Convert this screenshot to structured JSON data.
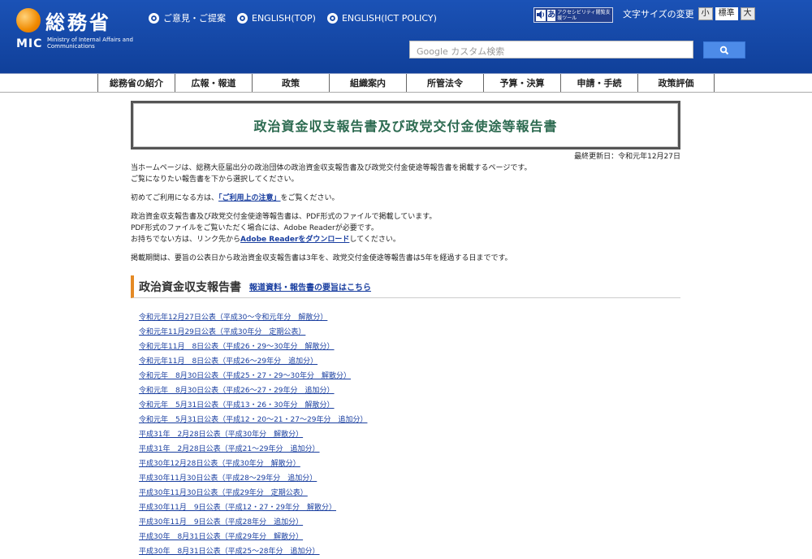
{
  "logo": {
    "jp": "総務省",
    "mic": "MIC",
    "en": "Ministry of Internal Affairs and Communications"
  },
  "toplinks": [
    "ご意見・ご提案",
    "ENGLISH(TOP)",
    "ENGLISH(ICT POLICY)"
  ],
  "accessibility": {
    "icon_a": "あ",
    "text": "アクセシビリティ閲覧支援ツール"
  },
  "fontsize": {
    "label": "文字サイズの変更",
    "small": "小",
    "normal": "標準",
    "large": "大"
  },
  "search": {
    "placeholder": "Google カスタム検索"
  },
  "nav": [
    "総務省の紹介",
    "広報・報道",
    "政策",
    "組織案内",
    "所管法令",
    "予算・決算",
    "申請・手続",
    "政策評価"
  ],
  "title": "政治資金収支報告書及び政党交付金使途等報告書",
  "last_updated": "最終更新日：令和元年12月27日",
  "intro1": "当ホームページは、総務大臣届出分の政治団体の政治資金収支報告書及び政党交付金使途等報告書を掲載するページです。",
  "intro2": "ご覧になりたい報告書を下から選択してください。",
  "notice": {
    "pre": "初めてご利用になる方は、",
    "link": "「ご利用上の注意」",
    "post": "をご覧ください。"
  },
  "pdf1": "政治資金収支報告書及び政党交付金使途等報告書は、PDF形式のファイルで掲載しています。",
  "pdf2": "PDF形式のファイルをご覧いただく場合には、Adobe Readerが必要です。",
  "pdf3": {
    "pre": "お持ちでない方は、リンク先から",
    "link": "Adobe Readerをダウンロード",
    "post": "してください。"
  },
  "period": "掲載期間は、要旨の公表日から政治資金収支報告書は3年を、政党交付金使途等報告書は5年を経過する日までです。",
  "section": {
    "title": "政治資金収支報告書",
    "link": "報道資料・報告書の要旨はこちら"
  },
  "reports": [
    "令和元年12月27日公表（平成30～令和元年分　解散分）",
    "令和元年11月29日公表（平成30年分　定期公表）",
    "令和元年11月　8日公表（平成26・29～30年分　解散分）",
    "令和元年11月　8日公表（平成26～29年分　追加分）",
    "令和元年　8月30日公表（平成25・27・29～30年分　解散分）",
    "令和元年　8月30日公表（平成26～27・29年分　追加分）",
    "令和元年　5月31日公表（平成13・26・30年分　解散分）",
    "令和元年　5月31日公表（平成12・20～21・27～29年分　追加分）",
    "平成31年　2月28日公表（平成30年分　解散分）",
    "平成31年　2月28日公表（平成21～29年分　追加分）",
    "平成30年12月28日公表（平成30年分　解散分）",
    "平成30年11月30日公表（平成28～29年分　追加分）",
    "平成30年11月30日公表（平成29年分　定期公表）",
    "平成30年11月　9日公表（平成12・27・29年分　解散分）",
    "平成30年11月　9日公表（平成28年分　追加分）",
    "平成30年　8月31日公表（平成29年分　解散分）",
    "平成30年　8月31日公表（平成25～28年分　追加分）"
  ],
  "icons": {
    "search": "search-icon",
    "radio": "radio-icon"
  },
  "colors": {
    "header": "#1748a8",
    "title": "#2c6a50",
    "link": "#1a3fa0",
    "accent": "#e48a25"
  }
}
